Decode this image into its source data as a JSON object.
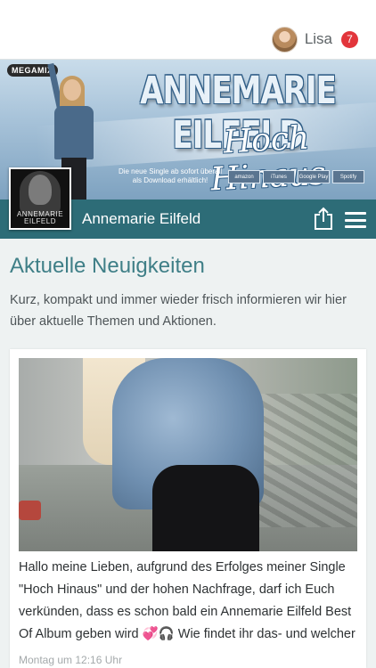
{
  "header": {
    "user_name": "Lisa",
    "notification_count": "7"
  },
  "banner": {
    "logo_label": "MEGAMIX",
    "title": "ANNEMARIE EILFELD",
    "subtitle": "Hoch Hinaus",
    "note": "Die neue Single ab sofort überall als Download erhältlich!",
    "stores": [
      "amazon",
      "iTunes",
      "Google Play",
      "Spotify"
    ]
  },
  "profile": {
    "artist_name": "Annemarie Eilfeld",
    "thumb_caption": "ANNEMARIE EILFELD"
  },
  "news": {
    "title": "Aktuelle Neuigkeiten",
    "intro": "Kurz, kompakt und immer wieder frisch informieren wir hier über aktuelle Themen und Aktionen.",
    "post": {
      "text": "Hallo meine Lieben, aufgrund des Erfolges meiner Single \"Hoch Hinaus\" und der hohen Nachfrage, darf ich Euch verkünden, dass es schon bald ein Annemarie Eilfeld Best Of Album geben wird 💞🎧 Wie findet ihr das- und welcher",
      "timestamp": "Montag um 12:16 Uhr"
    }
  },
  "colors": {
    "accent": "#2d6c77",
    "title": "#3f7f87",
    "badge": "#e2353b"
  }
}
